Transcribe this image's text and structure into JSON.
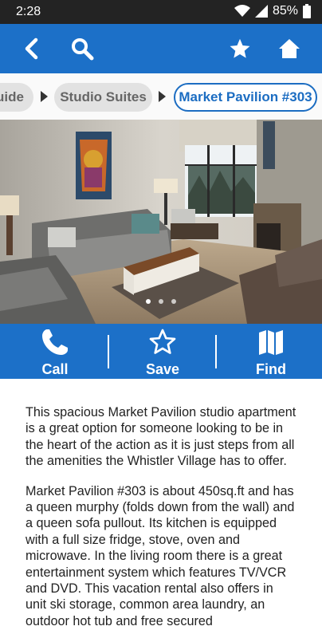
{
  "status": {
    "time": "2:28",
    "battery": "85%"
  },
  "app_bar": {
    "back_icon": "chevron-left-icon",
    "search_icon": "search-icon",
    "favorite_icon": "star-icon",
    "home_icon": "home-icon"
  },
  "breadcrumbs": [
    {
      "label": "uide"
    },
    {
      "label": "Studio Suites"
    },
    {
      "label": "Market Pavilion #303"
    }
  ],
  "gallery": {
    "page_count": 3,
    "current_page": 1
  },
  "actions": {
    "call": "Call",
    "save": "Save",
    "find": "Find"
  },
  "description": {
    "p1": "This spacious Market Pavilion studio apartment is a great option for someone looking to be in the heart of the action as it is just steps from all the amenities the Whistler Village has to offer.",
    "p2": "Market Pavilion #303 is about 450sq.ft and has a queen murphy (folds down from the wall) and a queen sofa pullout. Its kitchen is equipped with a full size fridge, stove, oven and microwave. In the living room there is a great entertainment system which features TV/VCR and DVD. This vacation rental also offers in unit ski storage, common area laundry, an outdoor hot tub and free secured"
  },
  "colors": {
    "primary": "#1c70c8",
    "status_bar": "#232323",
    "chip_active": "#1c6dc2"
  }
}
